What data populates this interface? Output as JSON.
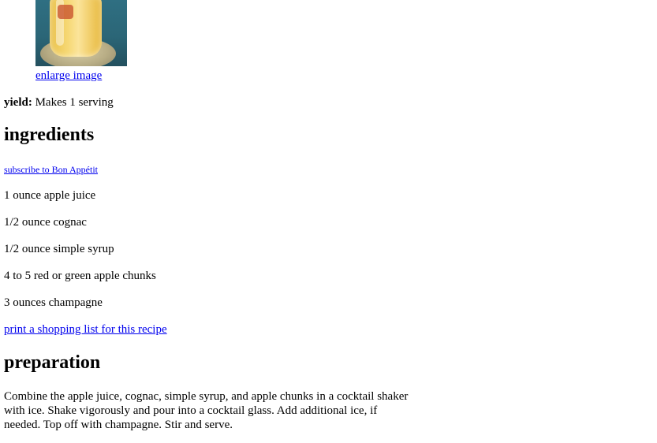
{
  "recipe": {
    "image_icon": "cocktail-photo",
    "enlarge_label": "enlarge image",
    "yield_label": "yield:",
    "yield_value": " Makes 1 serving",
    "ingredients_heading": "ingredients",
    "subscribe_label": "subscribe to Bon Appétit",
    "ingredients": [
      "1 ounce apple juice",
      "1/2 ounce cognac",
      "1/2 ounce simple syrup",
      "4 to 5 red or green apple chunks",
      "3 ounces champagne"
    ],
    "shopping_list_label": "print a shopping list for this recipe",
    "preparation_heading": "preparation",
    "preparation_text": "Combine the apple juice, cognac, simple syrup, and apple chunks in a cocktail shaker with ice. Shake vigorously and pour into a cocktail glass. Add additional ice, if needed. Top off with champagne. Stir and serve."
  },
  "colors": {
    "link": "#0000ee",
    "text": "#000000",
    "background": "#ffffff"
  }
}
